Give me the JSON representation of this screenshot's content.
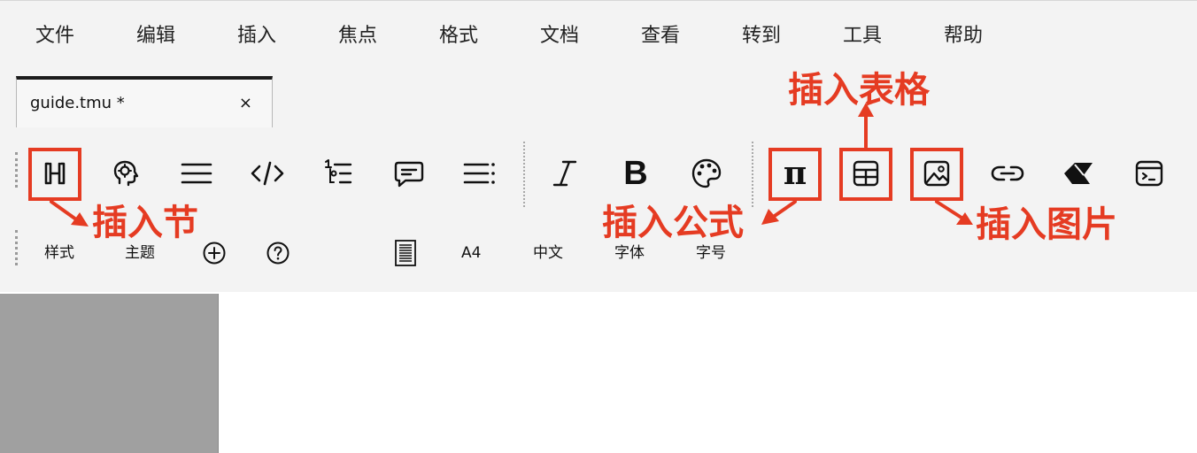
{
  "menu": {
    "items": [
      "文件",
      "编辑",
      "插入",
      "焦点",
      "格式",
      "文档",
      "查看",
      "转到",
      "工具",
      "帮助"
    ]
  },
  "tab": {
    "title": "guide.tmu *",
    "close": "×"
  },
  "toolbar": {
    "icons": [
      "heading-icon",
      "brain-icon",
      "paragraph-icon",
      "code-icon",
      "outline-list-icon",
      "comment-icon",
      "list-icon",
      "italic-icon",
      "bold-icon",
      "palette-icon",
      "formula-icon",
      "table-icon",
      "image-icon",
      "link-icon",
      "eraser-icon",
      "terminal-icon"
    ],
    "pi_label": "π",
    "bold_label": "B"
  },
  "row2": {
    "style": "样式",
    "theme": "主题",
    "page_size": "A4",
    "language": "中文",
    "font": "字体",
    "font_size": "字号"
  },
  "annotations": {
    "insert_section": "插入节",
    "insert_formula": "插入公式",
    "insert_table": "插入表格",
    "insert_image": "插入图片"
  },
  "colors": {
    "highlight": "#e53b22",
    "chrome": "#f3f3f3",
    "side_panel": "#a0a0a0"
  }
}
